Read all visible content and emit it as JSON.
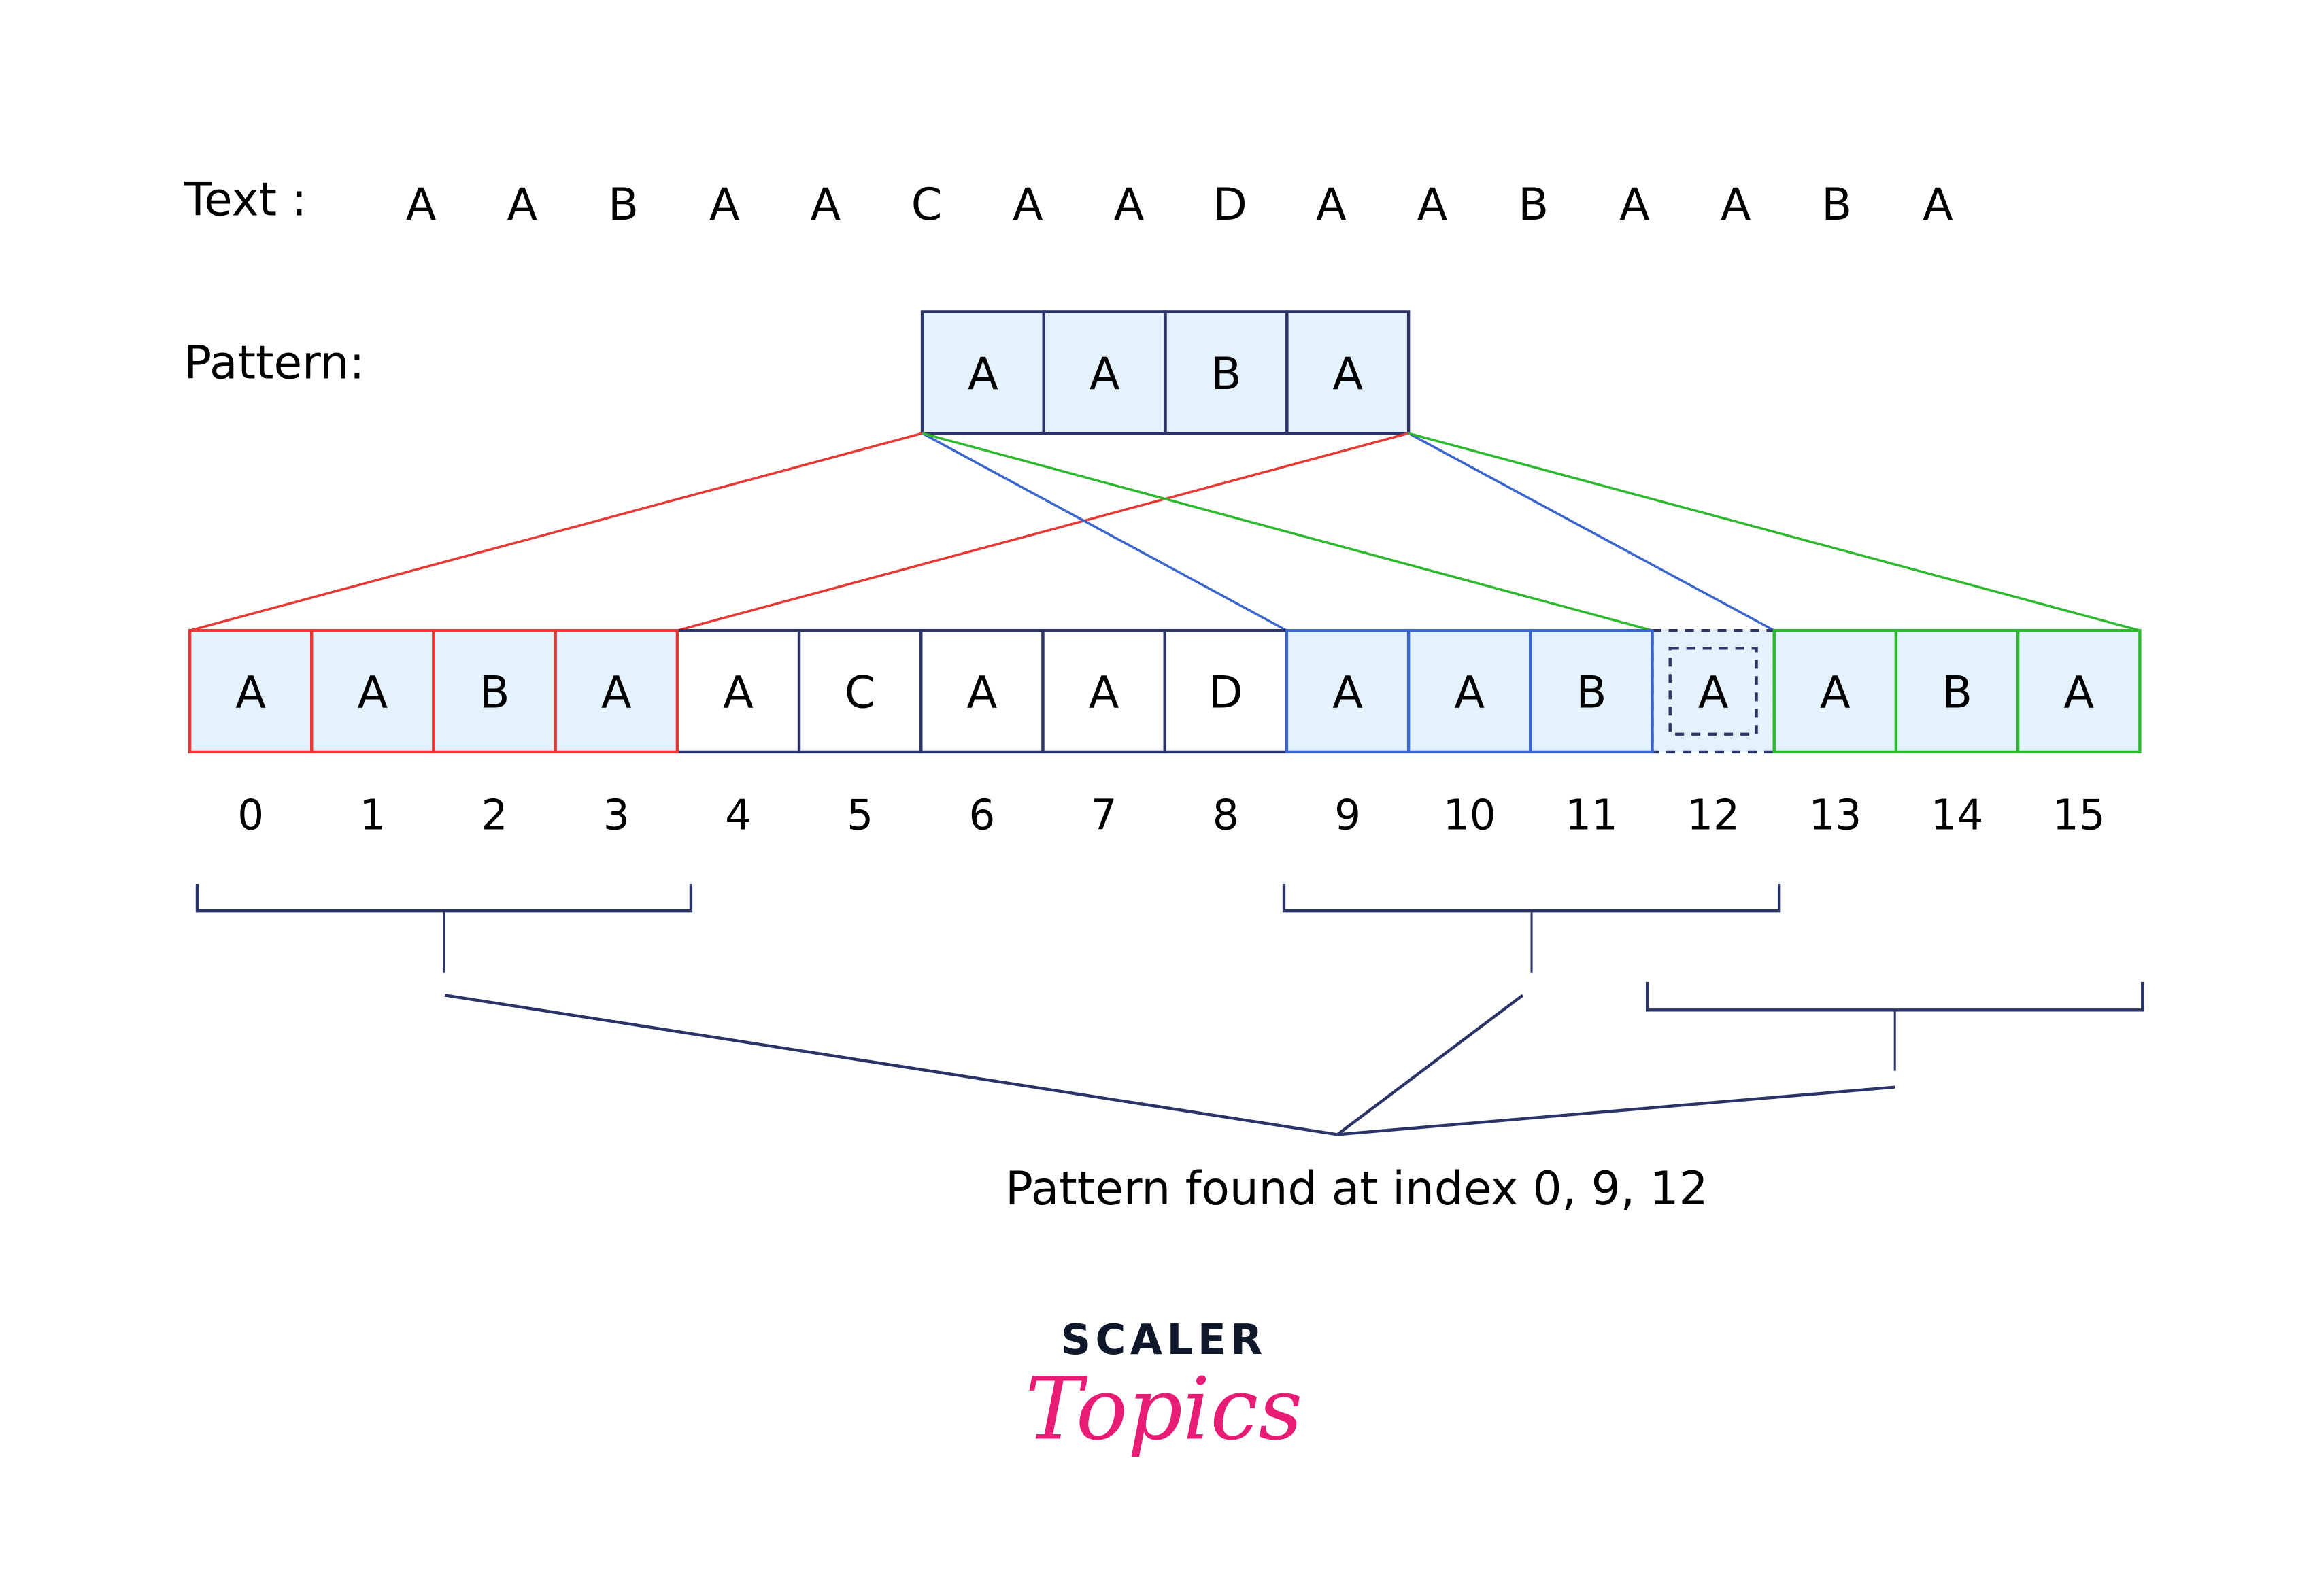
{
  "labels": {
    "text_label": "Text :",
    "pattern_label": "Pattern:",
    "result": "Pattern found at index 0, 9, 12"
  },
  "text": [
    "A",
    "A",
    "B",
    "A",
    "A",
    "C",
    "A",
    "A",
    "D",
    "A",
    "A",
    "B",
    "A",
    "A",
    "B",
    "A"
  ],
  "pattern": [
    "A",
    "A",
    "B",
    "A"
  ],
  "indices": [
    "0",
    "1",
    "2",
    "3",
    "4",
    "5",
    "6",
    "7",
    "8",
    "9",
    "10",
    "11",
    "12",
    "13",
    "14",
    "15"
  ],
  "matches": [
    {
      "start": 0,
      "color": "#e53935"
    },
    {
      "start": 9,
      "color": "#3a66cc"
    },
    {
      "start": 12,
      "color": "#2eb82e"
    }
  ],
  "colors": {
    "box_fill": "#e3f2fd",
    "dark": "#2b3467",
    "red": "#e53935",
    "blue": "#3a66cc",
    "green": "#2eb82e",
    "brand_pink": "#e81c74",
    "brand_dark": "#0f172a"
  },
  "logo": {
    "line1": "SCALER",
    "line2": "Topics"
  }
}
